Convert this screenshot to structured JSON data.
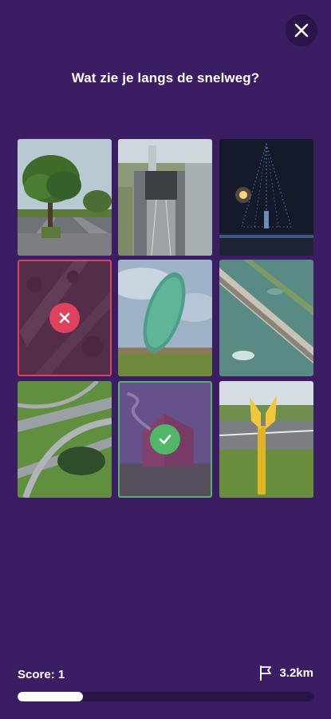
{
  "question": "Wat zie je langs de snelweg?",
  "score": {
    "label": "Score: 1"
  },
  "distance": {
    "label": "3.2km",
    "icon": "flag-icon"
  },
  "progress": {
    "fraction": 0.22
  },
  "colors": {
    "background": "#3a1d63",
    "wrong": "#e0415d",
    "right": "#4fb766"
  },
  "tiles": [
    {
      "name": "tree-highway",
      "state": "normal"
    },
    {
      "name": "tunnel-entrance",
      "state": "normal"
    },
    {
      "name": "light-tree-night",
      "state": "normal"
    },
    {
      "name": "aerial-forest-road",
      "state": "wrong"
    },
    {
      "name": "green-sculpture",
      "state": "normal"
    },
    {
      "name": "storm-barrier",
      "state": "normal"
    },
    {
      "name": "interchange",
      "state": "normal"
    },
    {
      "name": "red-house-smoke",
      "state": "right"
    },
    {
      "name": "yellow-post",
      "state": "normal"
    }
  ]
}
